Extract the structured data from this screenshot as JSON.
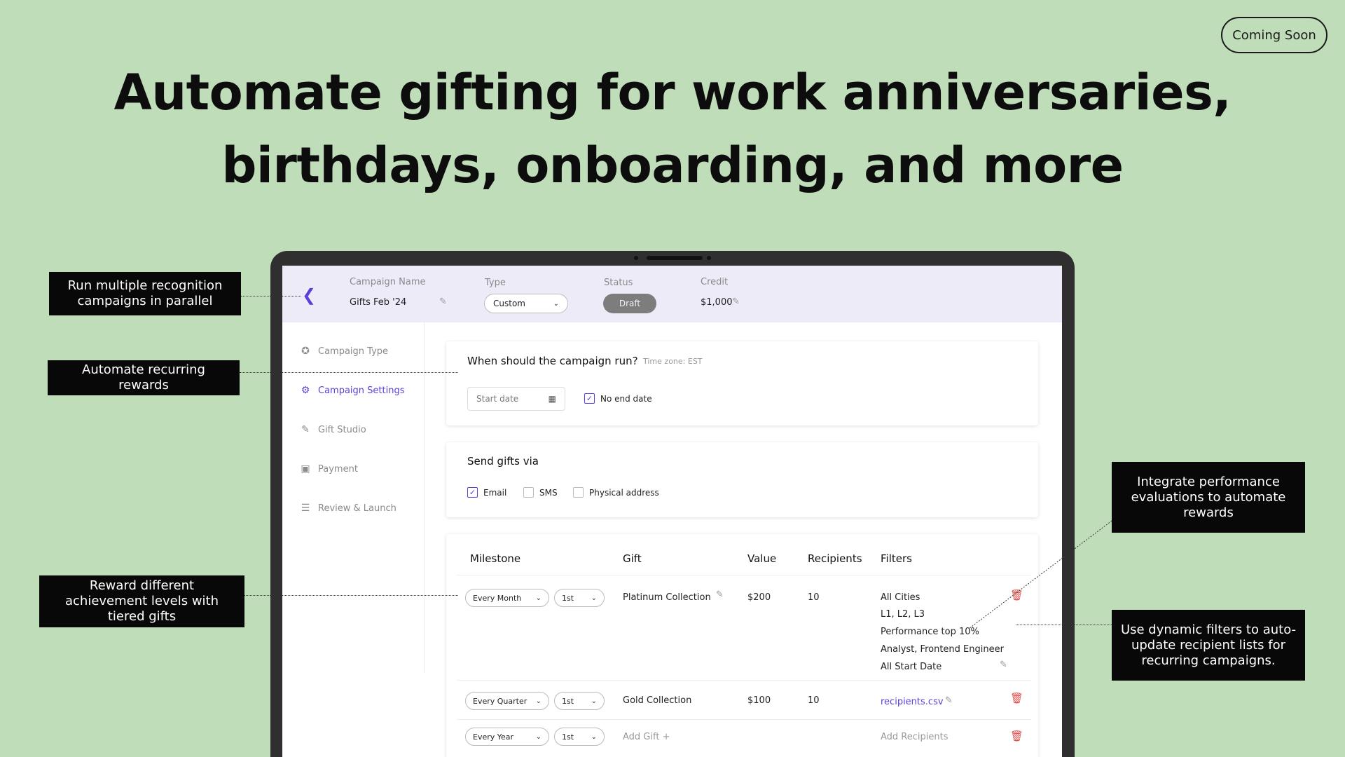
{
  "badge": "Coming Soon",
  "headline": {
    "line1": "Automate gifting for work anniversaries,",
    "line2": "birthdays, onboarding, and more"
  },
  "callouts": {
    "parallel": "Run multiple recognition campaigns in parallel",
    "recurring": "Automate recurring rewards",
    "tiered": "Reward different achievement levels with tiered gifts",
    "performance": "Integrate performance evaluations to automate rewards",
    "dynamic": "Use dynamic filters to auto-update recipient lists for recurring campaigns."
  },
  "topbar": {
    "campaign_name_label": "Campaign Name",
    "campaign_name_value": "Gifts Feb '24",
    "type_label": "Type",
    "type_value": "Custom",
    "status_label": "Status",
    "status_value": "Draft",
    "credit_label": "Credit",
    "credit_value": "$1,000"
  },
  "sidebar": {
    "items": [
      {
        "label": "Campaign Type",
        "icon": "badge-icon"
      },
      {
        "label": "Campaign Settings",
        "icon": "sliders-icon"
      },
      {
        "label": "Gift Studio",
        "icon": "gift-edit-icon"
      },
      {
        "label": "Payment",
        "icon": "wallet-icon"
      },
      {
        "label": "Review & Launch",
        "icon": "checklist-icon"
      }
    ]
  },
  "schedule": {
    "title": "When should the campaign run?",
    "timezone": "Time zone: EST",
    "start_placeholder": "Start date",
    "no_end_label": "No end date",
    "no_end_checked": true
  },
  "send_via": {
    "title": "Send gifts via",
    "options": [
      {
        "label": "Email",
        "checked": true
      },
      {
        "label": "SMS",
        "checked": false
      },
      {
        "label": "Physical address",
        "checked": false
      }
    ]
  },
  "milestones": {
    "headers": [
      "Milestone",
      "Gift",
      "Value",
      "Recipients",
      "Filters"
    ],
    "rows": [
      {
        "frequency": "Every Month",
        "ordinal": "1st",
        "gift": "Platinum Collection",
        "value": "$200",
        "recipients": "10",
        "filters": [
          "All Cities",
          "L1, L2, L3",
          "Performance top 10%",
          "Analyst, Frontend Engineer",
          "All Start Date"
        ]
      },
      {
        "frequency": "Every Quarter",
        "ordinal": "1st",
        "gift": "Gold Collection",
        "value": "$100",
        "recipients": "10",
        "filters_link": "recipients.csv"
      },
      {
        "frequency": "Every Year",
        "ordinal": "1st",
        "gift_placeholder": "Add Gift +",
        "recipients_placeholder": "Add Recipients"
      }
    ]
  }
}
